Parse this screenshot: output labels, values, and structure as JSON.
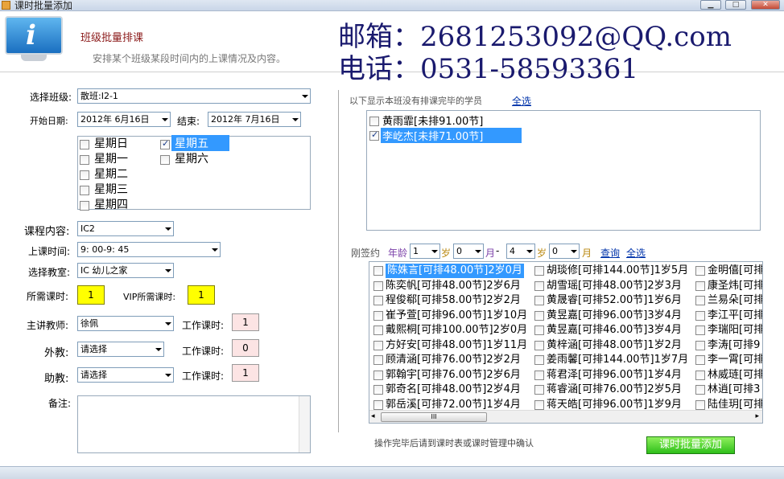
{
  "window": {
    "title": "课时批量添加",
    "min_label": "▁",
    "max_label": "□",
    "close_label": "✕"
  },
  "header": {
    "title": "班级批量排课",
    "subtitle": "安排某个班级某段时间内的上课情况及内容。",
    "email": "邮箱：2681253092@QQ.com",
    "phone": "电话：0531-58593361"
  },
  "form": {
    "class_label": "选择班级:",
    "class_value": "散班:I2-1",
    "start_label": "开始日期:",
    "start_value": "2012年 6月16日",
    "end_label": "结束:",
    "end_value": "2012年 7月16日",
    "weekdays": [
      {
        "label": "星期日",
        "checked": false
      },
      {
        "label": "星期一",
        "checked": false
      },
      {
        "label": "星期二",
        "checked": false
      },
      {
        "label": "星期三",
        "checked": false
      },
      {
        "label": "星期四",
        "checked": false
      },
      {
        "label": "星期五",
        "checked": true
      },
      {
        "label": "星期六",
        "checked": false
      }
    ],
    "course_label": "课程内容:",
    "course_value": "IC2",
    "time_label": "上课时间:",
    "time_value": "9: 00-9: 45",
    "room_label": "选择教室:",
    "room_value": "IC 幼儿之家",
    "hours_label": "所需课时:",
    "hours_value": "1",
    "vip_label": "VIP所需课时:",
    "vip_value": "1",
    "teacher_label": "主讲教师:",
    "teacher_value": "徐佩",
    "work_label": "工作课时:",
    "teacher_work": "1",
    "foreign_label": "外教:",
    "foreign_value": "请选择",
    "foreign_work": "0",
    "assistant_label": "助教:",
    "assistant_value": "请选择",
    "assistant_work": "1",
    "memo_label": "备注:"
  },
  "right": {
    "unscheduled_label": "以下显示本班没有排课完毕的学员",
    "select_all": "全选",
    "students": [
      {
        "text": "黄雨霏[未排91.00节]",
        "checked": false,
        "selected": false
      },
      {
        "text": "李屹杰[未排71.00节]",
        "checked": true,
        "selected": true
      }
    ],
    "signed_label": "刚签约",
    "age_label": "年龄",
    "age_from_year": "1",
    "year_unit": "岁",
    "age_from_month": "0",
    "month_unit": "月",
    "dash": "-",
    "age_to_year": "4",
    "age_to_month": "0",
    "query": "查询",
    "select_all2": "全选",
    "grid_col1": [
      "陈姝言[可排48.00节]2岁0月",
      "陈奕帆[可排48.00节]2岁6月",
      "程俊郗[可排58.00节]2岁2月",
      "崔予萱[可排96.00节]1岁10月",
      "戴熙桐[可排100.00节]2岁0月",
      "方好安[可排48.00节]1岁11月",
      "顾清涵[可排76.00节]2岁2月",
      "郭翰宇[可排76.00节]2岁6月",
      "郭奇名[可排48.00节]2岁4月",
      "郭岳溪[可排72.00节]1岁4月"
    ],
    "grid_col2": [
      "胡琰修[可排144.00节]1岁5月",
      "胡雪瑶[可排48.00节]2岁3月",
      "黄晟睿[可排52.00节]1岁6月",
      "黄昱嘉[可排96.00节]3岁4月",
      "黄昱嘉[可排46.00节]3岁4月",
      "黄梓涵[可排48.00节]1岁2月",
      "姜雨馨[可排144.00节]1岁7月",
      "蒋君泽[可排96.00节]1岁4月",
      "蒋睿涵[可排76.00节]2岁5月",
      "蒋天皓[可排96.00节]1岁9月"
    ],
    "grid_col3": [
      "金明僖[可排",
      "康圣炜[可排",
      "兰易朵[可排",
      "李江平[可排",
      "李瑞阳[可排",
      "李涛[可排9",
      "李一霄[可排",
      "林威琏[可排",
      "林逍[可排3",
      "陆佳玥[可排"
    ],
    "scroll_thumb": "III",
    "hint": "操作完毕后请到课时表或课时管理中确认",
    "submit": "课时批量添加"
  }
}
